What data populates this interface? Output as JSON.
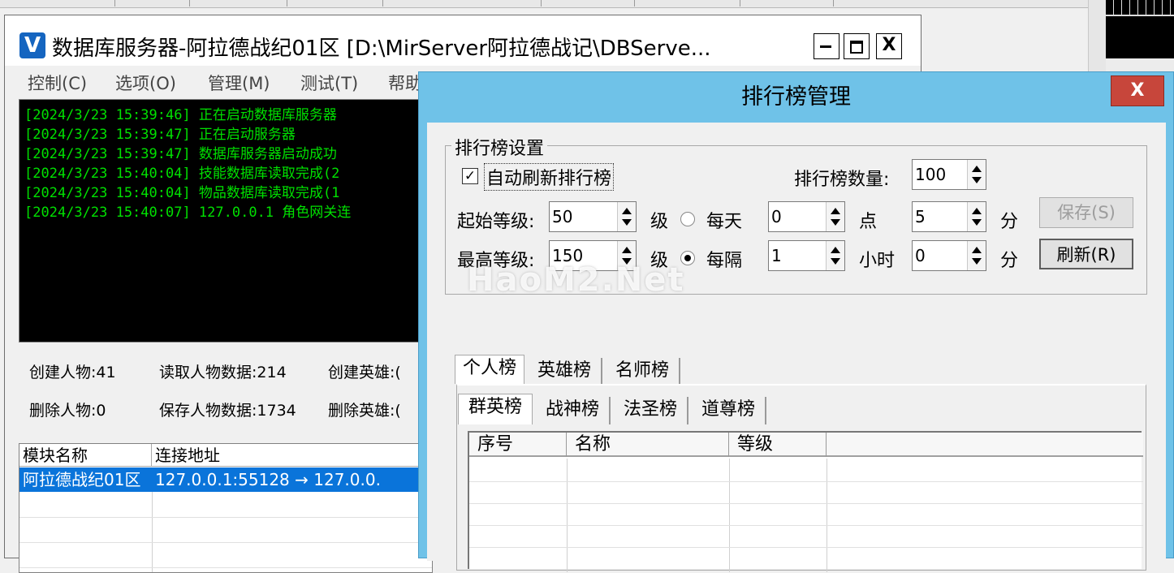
{
  "db_window": {
    "title": "数据库服务器-阿拉德战纪01区  [D:\\MirServer阿拉德战记\\DBServe...",
    "app_icon_letter": "V",
    "close_glyph": "X",
    "menu": [
      "控制(C)",
      "选项(O)",
      "管理(M)",
      "测试(T)",
      "帮助"
    ],
    "log_lines": [
      "[2024/3/23 15:39:46] 正在启动数据库服务器",
      "[2024/3/23 15:39:47] 正在启动服务器",
      "[2024/3/23 15:39:47] 数据库服务器启动成功",
      "[2024/3/23 15:40:04] 技能数据库读取完成(2",
      "[2024/3/23 15:40:04] 物品数据库读取完成(1",
      "[2024/3/23 15:40:07] 127.0.0.1 角色网关连"
    ],
    "stats": {
      "create_char": "创建人物:41",
      "read_char": "读取人物数据:214",
      "create_hero": "创建英雄:(",
      "delete_char": "删除人物:0",
      "save_char": "保存人物数据:1734",
      "delete_hero": "删除英雄:("
    },
    "list": {
      "columns": [
        "模块名称",
        "连接地址"
      ],
      "rows": [
        {
          "module": "阿拉德战纪01区",
          "address": "127.0.0.1:55128 → 127.0.0."
        }
      ]
    }
  },
  "rank_dialog": {
    "title": "排行榜管理",
    "close_glyph": "X",
    "settings_group": "排行榜设置",
    "auto_refresh_label": "自动刷新排行榜",
    "auto_refresh_checked": true,
    "check_glyph": "✓",
    "rank_count_label": "排行榜数量:",
    "rank_count": "100",
    "start_level_label": "起始等级:",
    "start_level": "50",
    "max_level_label": "最高等级:",
    "max_level": "150",
    "level_unit": "级",
    "daily_label": "每天",
    "daily_selected": false,
    "daily_hour": "0",
    "hour_point": "点",
    "daily_minute": "5",
    "minute_unit": "分",
    "interval_label": "每隔",
    "interval_selected": true,
    "interval_hours": "1",
    "hours_unit": "小时",
    "interval_minutes": "0",
    "save_button": "保存(S)",
    "refresh_button": "刷新(R)",
    "tabs": [
      "个人榜",
      "英雄榜",
      "名师榜"
    ],
    "sub_tabs": [
      "群英榜",
      "战神榜",
      "法圣榜",
      "道尊榜"
    ],
    "columns": [
      "序号",
      "名称",
      "等级"
    ]
  },
  "watermark": "HaoM2.Net"
}
